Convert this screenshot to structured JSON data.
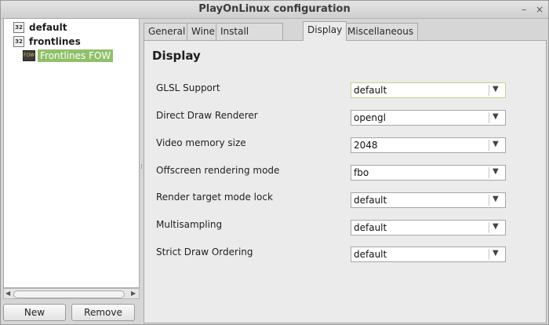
{
  "window": {
    "title": "PlayOnLinux configuration",
    "minimize_glyph": "–",
    "close_glyph": "×"
  },
  "tree": {
    "items": [
      {
        "label": "default",
        "icon": "32"
      },
      {
        "label": "frontlines",
        "icon": "32"
      }
    ],
    "selected_child": {
      "label": "Frontlines FOW",
      "icon": "FOW"
    }
  },
  "buttons": {
    "new": "New",
    "remove": "Remove"
  },
  "scrollbar": {
    "left_arrow": "◀",
    "right_arrow": "▶"
  },
  "tabs": [
    {
      "label": "General"
    },
    {
      "label": "Wine"
    },
    {
      "label": "Install components"
    },
    {
      "label": "Display"
    },
    {
      "label": "Miscellaneous"
    }
  ],
  "active_tab": "Display",
  "display": {
    "heading": "Display",
    "arrow_glyph": "▼",
    "settings": [
      {
        "label": "GLSL Support",
        "value": "default"
      },
      {
        "label": "Direct Draw Renderer",
        "value": "opengl"
      },
      {
        "label": "Video memory size",
        "value": "2048"
      },
      {
        "label": "Offscreen rendering mode",
        "value": "fbo"
      },
      {
        "label": "Render target mode lock",
        "value": "default"
      },
      {
        "label": "Multisampling",
        "value": "default"
      },
      {
        "label": "Strict Draw Ordering",
        "value": "default"
      }
    ]
  },
  "colors": {
    "selection": "#8fc06a",
    "window_bg": "#d6d6d6",
    "panel_bg": "#ebebeb"
  }
}
